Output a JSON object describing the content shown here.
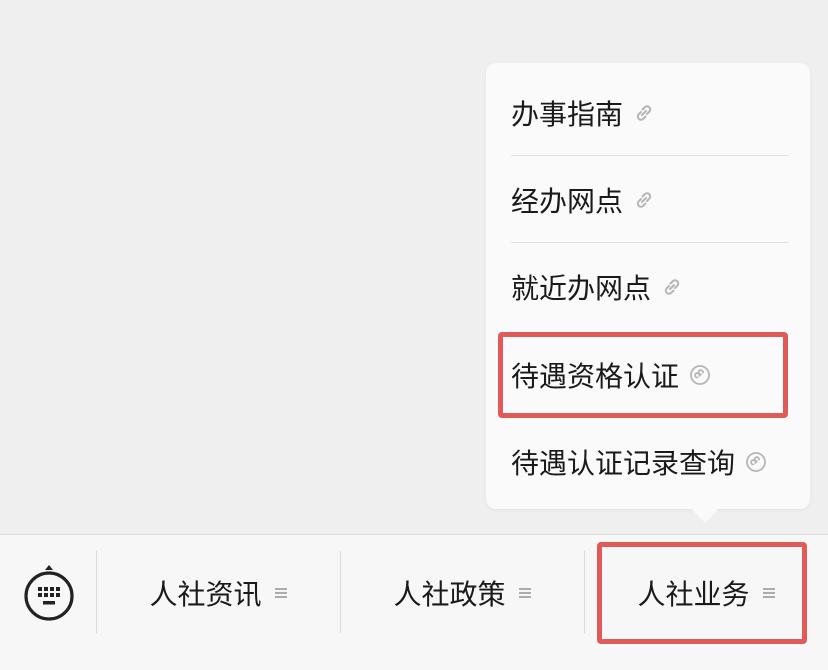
{
  "popup_menu": {
    "items": [
      {
        "label": "办事指南",
        "icon": "link-icon"
      },
      {
        "label": "经办网点",
        "icon": "link-icon"
      },
      {
        "label": "就近办网点",
        "icon": "link-icon"
      },
      {
        "label": "待遇资格认证",
        "icon": "mini-program-icon"
      },
      {
        "label": "待遇认证记录查询",
        "icon": "mini-program-icon"
      }
    ]
  },
  "bottom_menu": {
    "keyboard_icon": "keyboard-icon",
    "tabs": [
      {
        "label": "人社资讯",
        "icon": "menu-lines-icon"
      },
      {
        "label": "人社政策",
        "icon": "menu-lines-icon"
      },
      {
        "label": "人社业务",
        "icon": "menu-lines-icon"
      }
    ]
  },
  "colors": {
    "highlight": "#e05a5a",
    "background": "#efeff0",
    "popup": "#fafafa",
    "bar": "#f7f7f7"
  }
}
